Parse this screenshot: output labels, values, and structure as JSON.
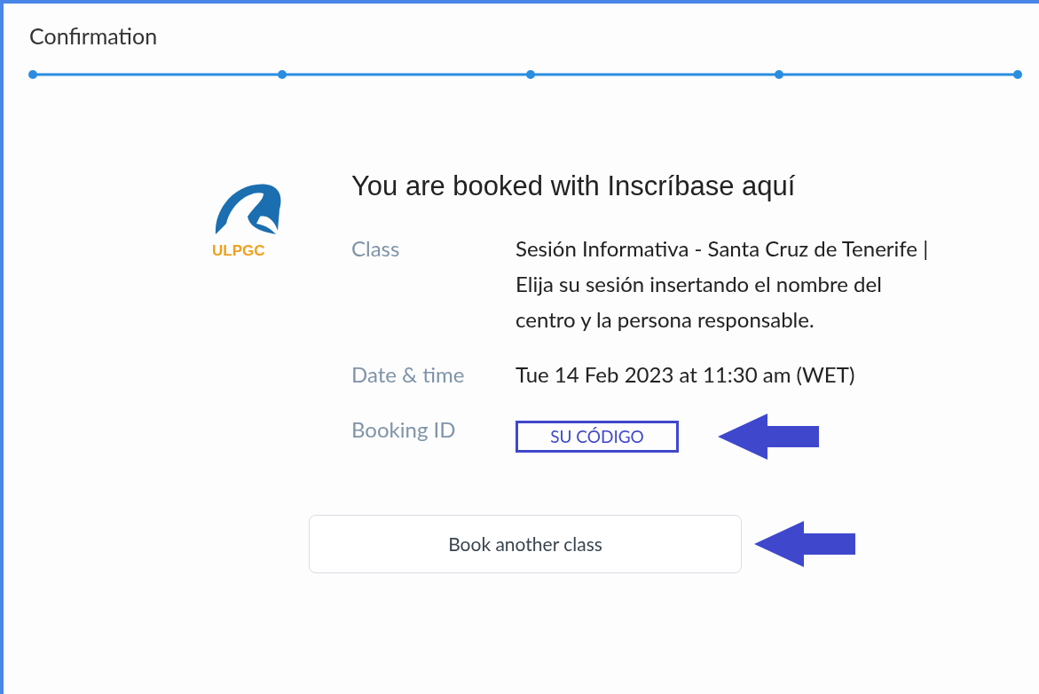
{
  "title": "Confirmation",
  "logo": {
    "text": "ULPGC"
  },
  "heading": "You are booked with Inscríbase aquí",
  "details": [
    {
      "label": "Class",
      "value": "Sesión Informativa - Santa Cruz de Tenerife | Elija su sesión insertando el nombre del centro y la persona responsable.",
      "kind": "text"
    },
    {
      "label": "Date & time",
      "value": "Tue 14 Feb 2023 at 11:30 am (WET)",
      "kind": "text"
    },
    {
      "label": "Booking ID",
      "value": "SU CÓDIGO",
      "kind": "code"
    }
  ],
  "button": "Book another class"
}
